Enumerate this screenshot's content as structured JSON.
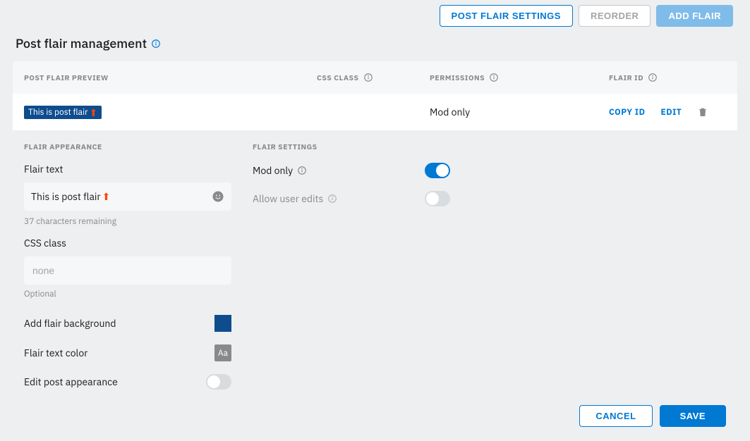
{
  "header": {
    "post_flair_settings": "Post Flair Settings",
    "reorder": "Reorder",
    "add_flair": "Add Flair"
  },
  "page": {
    "title": "Post flair management"
  },
  "table": {
    "headers": {
      "preview": "Post Flair Preview",
      "css_class": "CSS Class",
      "permissions": "Permissions",
      "flair_id": "Flair ID"
    },
    "row": {
      "flair_text": "This is post flair",
      "css_class": "",
      "permissions": "Mod only",
      "copy_id": "Copy ID",
      "edit": "Edit"
    }
  },
  "editor": {
    "appearance": {
      "section": "Flair Appearance",
      "flair_text_label": "Flair text",
      "flair_text_value": "This is post flair",
      "chars_remaining": "37 characters remaining",
      "css_class_label": "CSS class",
      "css_class_placeholder": "none",
      "css_class_helper": "Optional",
      "bg_label": "Add flair background",
      "bg_color": "#0e4c8e",
      "text_color_label": "Flair text color",
      "text_color_sample": "Aa",
      "edit_post_appearance_label": "Edit post appearance",
      "edit_post_appearance_on": false
    },
    "settings": {
      "section": "Flair Settings",
      "mod_only_label": "Mod only",
      "mod_only_on": true,
      "allow_user_edits_label": "Allow user edits",
      "allow_user_edits_on": false
    }
  },
  "footer": {
    "cancel": "Cancel",
    "save": "Save"
  }
}
